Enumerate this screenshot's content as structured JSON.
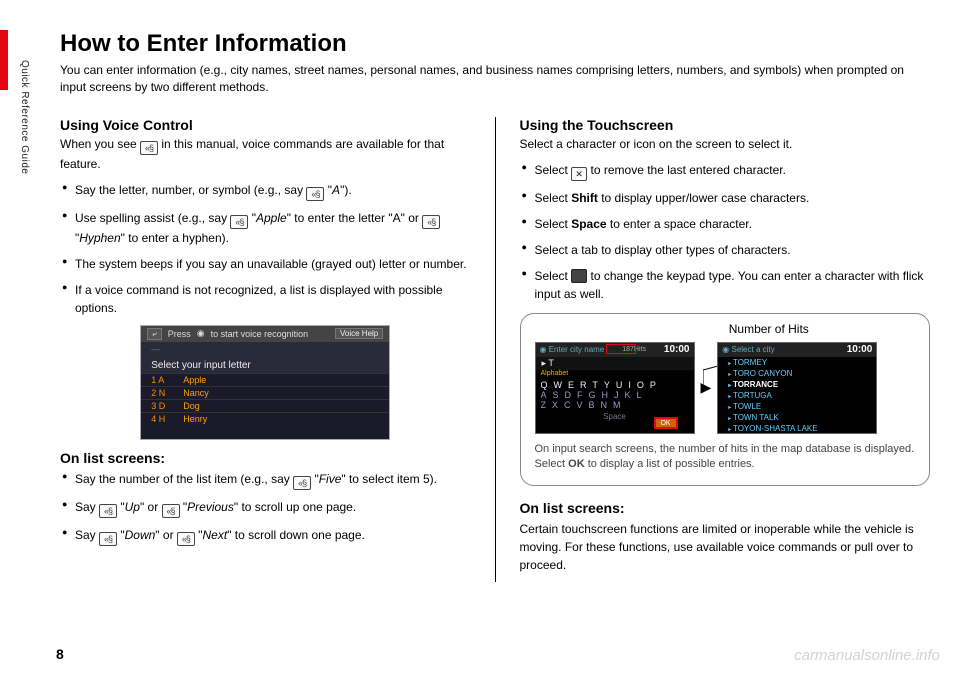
{
  "side_label": "Quick Reference Guide",
  "page_number": "8",
  "watermark": "carmanualsonline.info",
  "title": "How to Enter Information",
  "intro": "You can enter information (e.g., city names, street names, personal names, and business names comprising letters, numbers, and symbols) when prompted on input screens by two different methods.",
  "left": {
    "h2": "Using Voice Control",
    "sub_a": "When you see ",
    "sub_b": " in this manual, voice commands are available for that feature.",
    "b1_a": "Say the letter, number, or symbol (e.g., say ",
    "b1_b": " \"",
    "b1_c": "A",
    "b1_d": "\").",
    "b2_a": "Use spelling assist (e.g., say ",
    "b2_b": " \"",
    "b2_c": "Apple",
    "b2_d": "\" to enter the letter \"A\" or ",
    "b2_e": " \"",
    "b2_f": "Hyphen",
    "b2_g": "\" to enter a hyphen).",
    "b3": "The system beeps if you say an unavailable (grayed out) letter or number.",
    "b4": "If a voice command is not recognized, a list is displayed with possible options.",
    "shot": {
      "press": "Press",
      "hint": "to start voice recognition",
      "voicehelp": "Voice Help",
      "prompt": "Select your input letter",
      "rows": [
        {
          "n": "1 A",
          "w": "Apple"
        },
        {
          "n": "2 N",
          "w": "Nancy"
        },
        {
          "n": "3 D",
          "w": "Dog"
        },
        {
          "n": "4 H",
          "w": "Henry"
        }
      ]
    },
    "h3": "On list screens:",
    "c1_a": "Say the number of the list item (e.g., say ",
    "c1_b": " \"",
    "c1_c": "Five",
    "c1_d": "\" to select item 5).",
    "c2_a": "Say ",
    "c2_b": " \"",
    "c2_up": "Up",
    "c2_c": "\" or ",
    "c2_d": " \"",
    "c2_prev": "Previous",
    "c2_e": "\" to scroll up one page.",
    "c3_a": "Say ",
    "c3_b": " \"",
    "c3_down": "Down",
    "c3_c": "\" or ",
    "c3_d": " \"",
    "c3_next": "Next",
    "c3_e": "\" to scroll down one page."
  },
  "right": {
    "h2": "Using the Touchscreen",
    "sub": "Select a character or icon on the screen to select it.",
    "b1_a": "Select ",
    "b1_key": "✕",
    "b1_b": " to remove the last entered character.",
    "b2_a": "Select ",
    "b2_bold": "Shift",
    "b2_b": " to display upper/lower case characters.",
    "b3_a": "Select ",
    "b3_bold": "Space",
    "b3_b": " to enter a space character.",
    "b4": "Select a tab to display other types of characters.",
    "b5_a": "Select ",
    "b5_b": " to change the keypad type. You can enter a character with flick input as well.",
    "fig_label": "Number of Hits",
    "shot1": {
      "title": "Enter city name",
      "hits": "187Hits",
      "time": "10:00",
      "tab": "Alphabet",
      "t": "T",
      "row1": "QWERTYUIOP",
      "row2": "ASDFGHJKL",
      "row3": "ZXCVBNM",
      "space": "Space",
      "ok": "OK"
    },
    "shot2": {
      "title": "Select a city",
      "time": "10:00",
      "items": [
        "TORMEY",
        "TORO CANYON",
        "TORRANCE",
        "TORTUGA",
        "TOWLE",
        "TOWN TALK",
        "TOYON-SHASTA LAKE"
      ]
    },
    "figcap_a": "On input search screens, the number of hits in the map database is displayed. Select ",
    "figcap_bold": "OK",
    "figcap_b": " to display a list of possible entries.",
    "h3": "On list screens:",
    "bottom": "Certain touchscreen functions are limited or inoperable while the vehicle is moving. For these functions, use available voice commands or pull over to proceed."
  }
}
